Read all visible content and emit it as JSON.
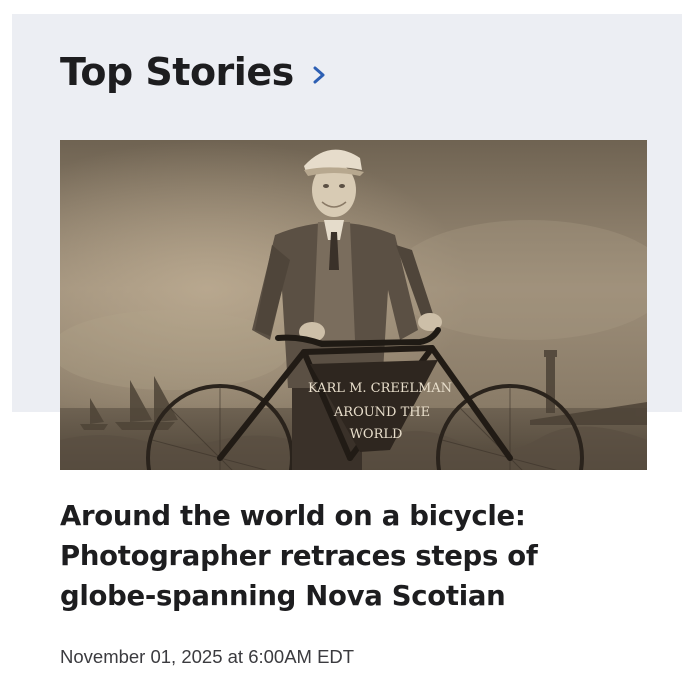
{
  "section": {
    "title": "Top Stories",
    "chevron_icon": "chevron-right-icon",
    "accent_color": "#2d5fb3",
    "band_color": "#eceef3"
  },
  "story": {
    "image_alt": "Vintage sepia photograph of a man in a cap and suit standing behind a bicycle",
    "image_text": [
      "KARL M. CREELMAN",
      "AROUND THE",
      "WORLD"
    ],
    "headline": "Around the world on a bicycle: Photographer retraces steps of globe-spanning Nova Scotian",
    "timestamp": "November 01, 2025 at 6:00AM EDT"
  }
}
